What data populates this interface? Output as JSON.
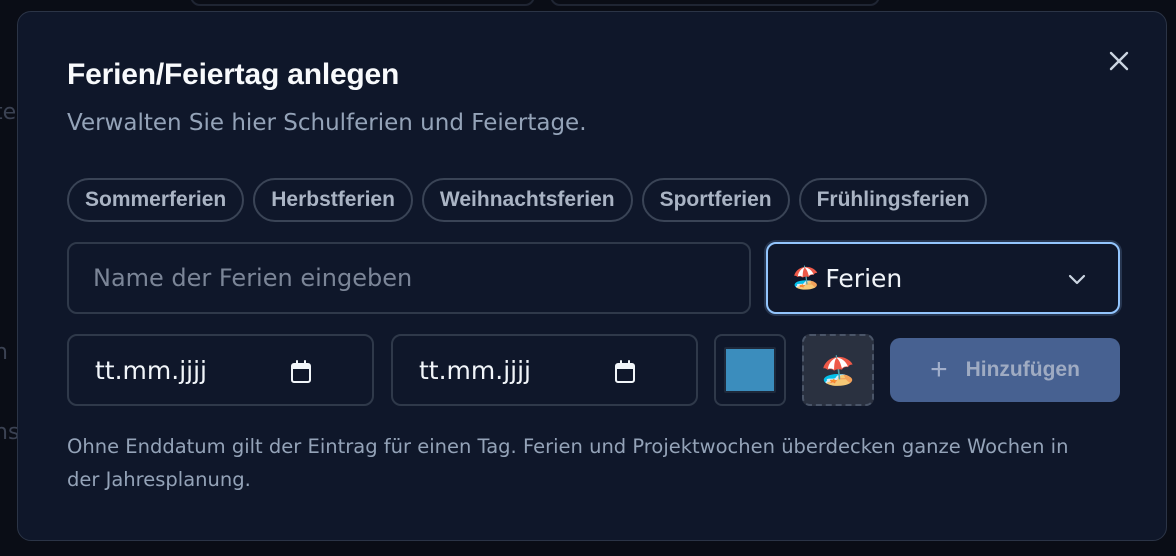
{
  "dialog": {
    "title": "Ferien/Feiertag anlegen",
    "subtitle": "Verwalten Sie hier Schulferien und Feiertage.",
    "close_icon": "close-icon"
  },
  "presets": [
    {
      "label": "Sommerferien"
    },
    {
      "label": "Herbstferien"
    },
    {
      "label": "Weihnachtsferien"
    },
    {
      "label": "Sportferien"
    },
    {
      "label": "Frühlingsferien"
    }
  ],
  "form": {
    "name_placeholder": "Name der Ferien eingeben",
    "name_value": "",
    "type_emoji": "🏖️",
    "type_selected": "Ferien",
    "start_date_placeholder": "tt.mm.jjjj",
    "end_date_placeholder": "tt.mm.jjjj",
    "color": "#3b8dbd",
    "emoji": "🏖️",
    "add_label": "Hinzufügen"
  },
  "hint": "Ohne Enddatum gilt der Eintrag für einen Tag. Ferien und Projektwochen überdecken ganze Wochen in der Jahresplanung.",
  "colors": {
    "modal_bg": "#0f172a",
    "accent_focus": "#93c5fd",
    "button_bg": "#4b6597"
  }
}
